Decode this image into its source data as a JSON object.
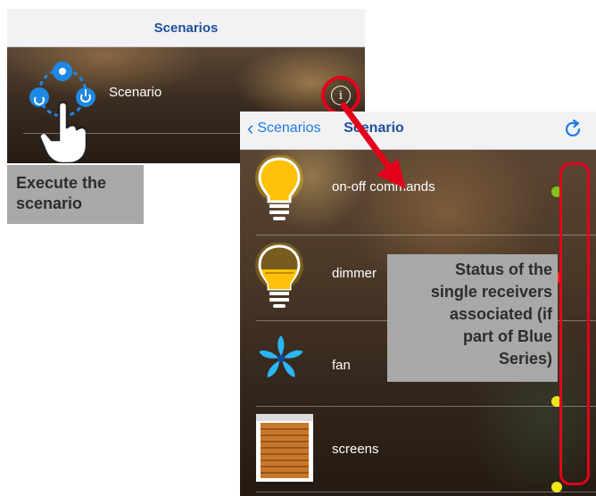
{
  "panel1": {
    "nav_title": "Scenarios",
    "row_label": "Scenario",
    "info_glyph": "i"
  },
  "callout_execute": {
    "line1": "Execute the",
    "line2": "scenario"
  },
  "panel2": {
    "back_label": "Scenarios",
    "title": "Scenario",
    "rows": [
      {
        "label": "on-off commands",
        "icon": "light-bulb-on-icon",
        "status_color": "#7fc31c"
      },
      {
        "label": "dimmer",
        "icon": "light-bulb-dimmer-icon",
        "status_color": "#e8341c"
      },
      {
        "label": "fan",
        "icon": "fan-icon",
        "status_color": "#f2e51a"
      },
      {
        "label": "screens",
        "icon": "roller-blind-icon",
        "status_color": "#f2e51a"
      }
    ]
  },
  "callout_status": {
    "line1": "Status of the",
    "line2": "single receivers",
    "line3": "associated (if",
    "line4": "part of Blue",
    "line5": "Series)"
  },
  "colors": {
    "accent_red": "#e3001b",
    "ios_blue": "#1e7ae8",
    "nav_title_blue": "#1d4f9a",
    "callout_grey": "#a8a8a8"
  }
}
